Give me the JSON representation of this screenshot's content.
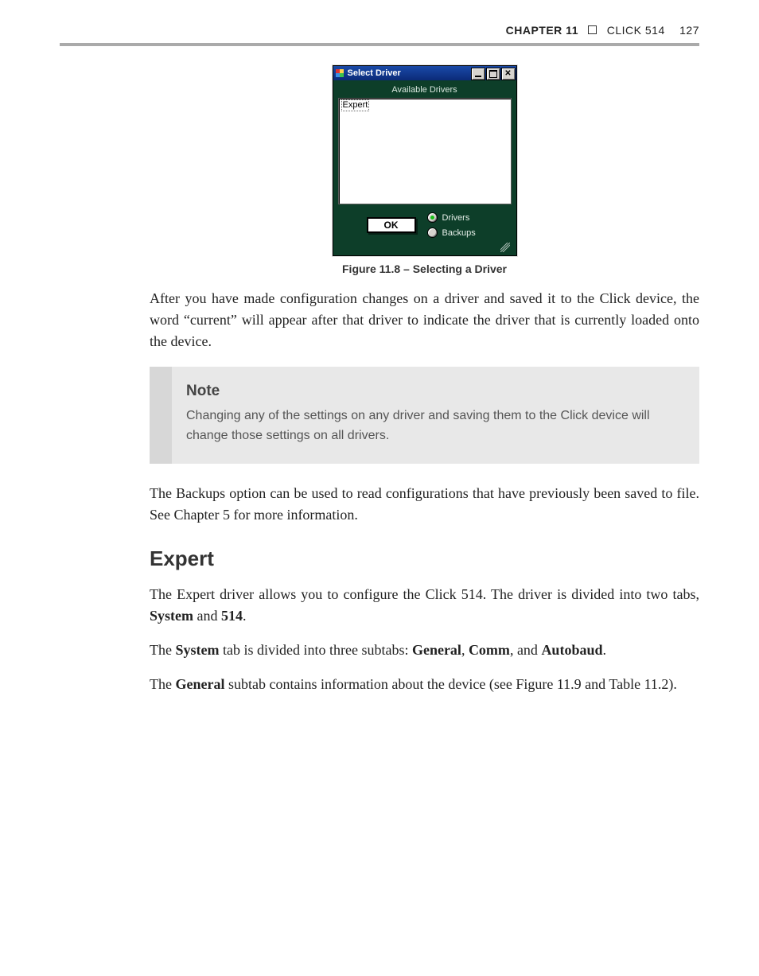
{
  "header": {
    "chapter_label": "CHAPTER 11",
    "separator": "☐",
    "section_label": "CLICK 514",
    "page_number": "127"
  },
  "dialog": {
    "title": "Select Driver",
    "available_label": "Available Drivers",
    "list_items": [
      "Expert"
    ],
    "selected_item": "Expert",
    "ok_label": "OK",
    "radios": {
      "drivers": {
        "label": "Drivers",
        "checked": true
      },
      "backups": {
        "label": "Backups",
        "checked": false
      }
    }
  },
  "figure": {
    "caption": "Figure 11.8 – Selecting a Driver"
  },
  "body": {
    "para1": "After you have made configuration changes on a driver and saved it to the Click device, the word “current” will appear after that driver to indicate the driver that is currently loaded onto the device.",
    "note_title": "Note",
    "note_body": "Changing any of the settings on any driver and saving them to the Click device will change those settings on all drivers.",
    "para2": "The Backups option can be used to read configurations that have previously been saved to file. See Chapter 5 for more information.",
    "expert_heading": "Expert",
    "expert_para1_pre": "The Expert driver allows you to configure the Click 514. The driver is divided into two tabs, ",
    "expert_para1_bold1": "System",
    "expert_para1_mid": " and ",
    "expert_para1_bold2": "514",
    "expert_para1_post": ".",
    "para4_pre": "The ",
    "para4_b1": "System",
    "para4_mid1": " tab is divided into three subtabs: ",
    "para4_b2": "General",
    "para4_mid2": ", ",
    "para4_b3": "Comm",
    "para4_mid3": ", and ",
    "para4_b4": "Autobaud",
    "para4_post": ".",
    "para5_pre": "The ",
    "para5_b1": "General",
    "para5_post": " subtab contains information about the device (see Figure 11.9 and Table 11.2)."
  }
}
